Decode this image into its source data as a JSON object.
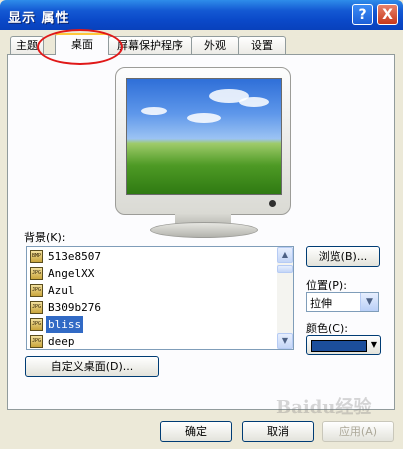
{
  "window": {
    "title": "显示 属性"
  },
  "titlebar": {
    "help_label": "?",
    "close_label": "X"
  },
  "tabs": [
    {
      "label": "主题",
      "active": false
    },
    {
      "label": "桌面",
      "active": true
    },
    {
      "label": "屏幕保护程序",
      "active": false
    },
    {
      "label": "外观",
      "active": false
    },
    {
      "label": "设置",
      "active": false
    }
  ],
  "background": {
    "label": "背景(K):",
    "items": [
      {
        "label": "513e8507",
        "icon": "BMP"
      },
      {
        "label": "AngelXX",
        "icon": "JPG"
      },
      {
        "label": "Azul",
        "icon": "JPG"
      },
      {
        "label": "B309b276",
        "icon": "JPG"
      },
      {
        "label": "bliss",
        "icon": "JPG",
        "selected": true
      },
      {
        "label": "deep",
        "icon": "JPG"
      }
    ]
  },
  "browse_button": "浏览(B)...",
  "position": {
    "label": "位置(P):",
    "value": "拉伸"
  },
  "color": {
    "label": "颜色(C):",
    "value": "#1C4E9B"
  },
  "customize_button": "自定义桌面(D)...",
  "footer": {
    "ok": "确定",
    "cancel": "取消",
    "apply": "应用(A)"
  },
  "watermark": "Baidu经验",
  "colors": {
    "title_bar": "#0A48C8",
    "selection": "#316AC5",
    "active_tab_accent": "#FFC83C",
    "annotation": "#E01818"
  }
}
